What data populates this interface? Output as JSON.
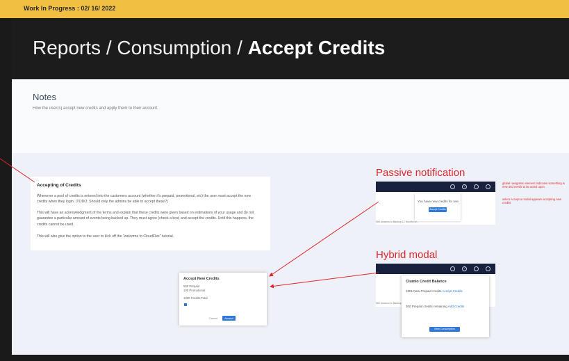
{
  "wip_banner": "Work In Progress : 02/ 16/ 2022",
  "title": {
    "prefix": "Reports / Consumption / ",
    "bold": "Accept Credits"
  },
  "notes": {
    "heading": "Notes",
    "body": "How the user(s) accept new credits and apply them to their account."
  },
  "accepting_card": {
    "heading": "Accepting of Credits",
    "p1": "Whenever a pool of credits is entered into the customers account (whether it's prepaid, promotional, etc) the user must accept the new credits when they login. (TODO: Should only the admins be able to accept these?)",
    "p2": "This will have an acknowledgment of the terms and explain that these credits were given based on estimations of your usage and do not guarantee a particular amount of events being backed up. They must agree (check a box) and accept the credits. Until this happens, the credits cannot be used.",
    "p3": "This will also give the option to the user to kick off the \"welcome to CloudFlex\" tutorial."
  },
  "accept_modal": {
    "title": "Accept New Credits",
    "lines": [
      "500 Prepaid",
      "100 Promotional",
      "1000 Credits Total"
    ],
    "cancel": "Cancel",
    "accept": "Accept"
  },
  "passive": {
    "label": "Passive notification",
    "message": "You have new credits for use.",
    "button": "Accept Credits",
    "footnote": "Still Amazon to Backup 12 Months of..."
  },
  "hybrid": {
    "label": "Hybrid modal",
    "popup_title": "Clumio Credit Balance",
    "line1": "2801 New Prepaid credits",
    "link1": "Accept Credits",
    "line2": "300 Prepaid credits remaining",
    "link2": "Add Credits",
    "button": "View Consumption",
    "footnote": "Still Amazon to Backup..."
  },
  "red_notes": {
    "n1": "global navigation element indicates something is new and needs to be acted upon",
    "n2": "select Accept a modal appears accepting new credits"
  },
  "colors": {
    "banner": "#f1bf42",
    "annotation": "#e0262b",
    "nav": "#18213d",
    "button": "#2f78d6"
  }
}
